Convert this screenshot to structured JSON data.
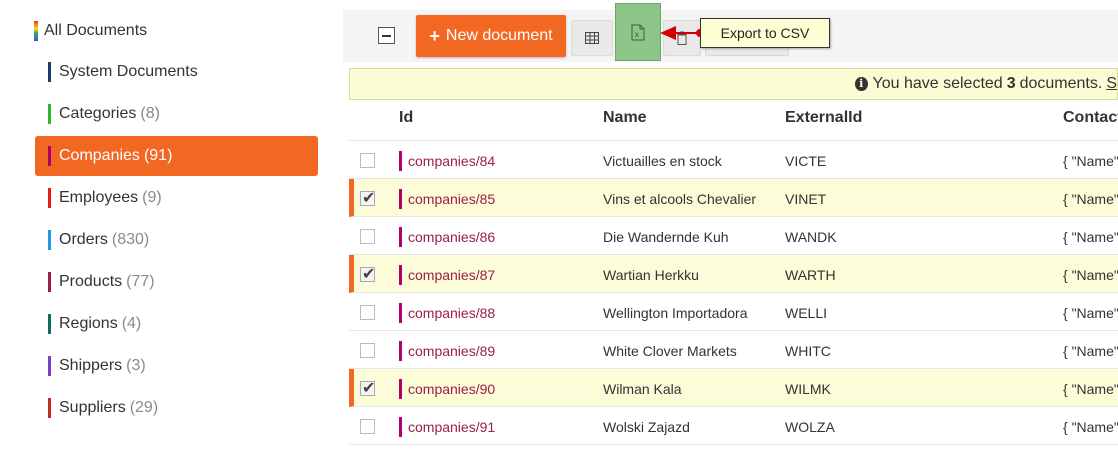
{
  "sidebar": {
    "all_documents": "All Documents",
    "items": [
      {
        "label": "System Documents",
        "count": "",
        "color": "#1a3a6b"
      },
      {
        "label": "Categories",
        "count": "(8)",
        "color": "#2db82d"
      },
      {
        "label": "Companies",
        "count": "(91)",
        "color": "#b0006e"
      },
      {
        "label": "Employees",
        "count": "(9)",
        "color": "#e31b1b"
      },
      {
        "label": "Orders",
        "count": "(830)",
        "color": "#1e9be0"
      },
      {
        "label": "Products",
        "count": "(77)",
        "color": "#9b1d4a"
      },
      {
        "label": "Regions",
        "count": "(4)",
        "color": "#0e6b5e"
      },
      {
        "label": "Shippers",
        "count": "(3)",
        "color": "#7a3fc9"
      },
      {
        "label": "Suppliers",
        "count": "(29)",
        "color": "#c62828"
      }
    ],
    "active_index": 2
  },
  "toolbar": {
    "new_document_label": "New document",
    "tooltip": "Export to CSV"
  },
  "banner": {
    "prefix": "You have selected",
    "count": "3",
    "suffix": "documents.",
    "link": "S"
  },
  "table": {
    "headers": {
      "id": "Id",
      "name": "Name",
      "external_id": "ExternalId",
      "contact": "Contact"
    },
    "rows": [
      {
        "id": "companies/84",
        "name": "Victuailles en stock",
        "external_id": "VICTE",
        "contact": "{ \"Name\"",
        "selected": false
      },
      {
        "id": "companies/85",
        "name": "Vins et alcools Chevalier",
        "external_id": "VINET",
        "contact": "{ \"Name\"",
        "selected": true
      },
      {
        "id": "companies/86",
        "name": "Die Wandernde Kuh",
        "external_id": "WANDK",
        "contact": "{ \"Name\"",
        "selected": false
      },
      {
        "id": "companies/87",
        "name": "Wartian Herkku",
        "external_id": "WARTH",
        "contact": "{ \"Name\"",
        "selected": true
      },
      {
        "id": "companies/88",
        "name": "Wellington Importadora",
        "external_id": "WELLI",
        "contact": "{ \"Name\"",
        "selected": false
      },
      {
        "id": "companies/89",
        "name": "White Clover Markets",
        "external_id": "WHITC",
        "contact": "{ \"Name\"",
        "selected": false
      },
      {
        "id": "companies/90",
        "name": "Wilman Kala",
        "external_id": "WILMK",
        "contact": "{ \"Name\"",
        "selected": true
      },
      {
        "id": "companies/91",
        "name": "Wolski Zajazd",
        "external_id": "WOLZA",
        "contact": "{ \"Name\"",
        "selected": false
      }
    ]
  },
  "colors": {
    "accent": "#f26722",
    "selected_row": "#fcfcd8",
    "csv_button": "#8dc48a"
  }
}
